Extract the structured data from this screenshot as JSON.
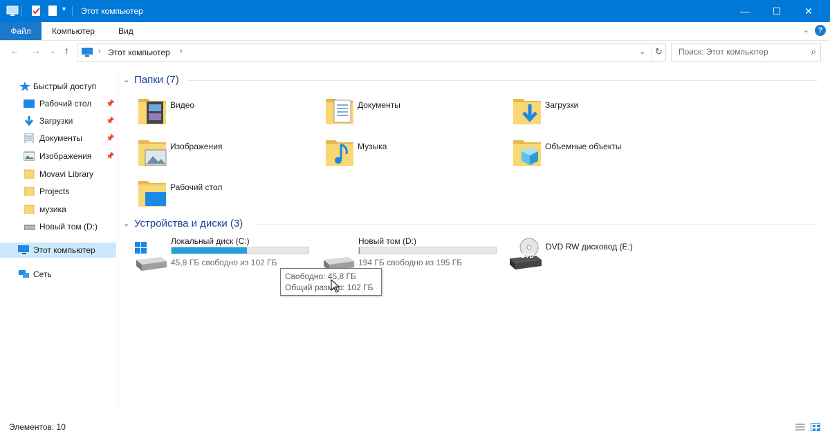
{
  "titlebar": {
    "title": "Этот компьютер",
    "controls": {
      "minimize": "—",
      "maximize": "☐",
      "close": "✕"
    }
  },
  "ribbon": {
    "file": "Файл",
    "tabs": [
      "Компьютер",
      "Вид"
    ],
    "help": "?"
  },
  "address": {
    "path": "Этот компьютер"
  },
  "search": {
    "placeholder": "Поиск: Этот компьютер"
  },
  "sidebar": {
    "items": [
      {
        "label": "Быстрый доступ",
        "icon": "star-icon"
      },
      {
        "label": "Рабочий стол",
        "icon": "desktop-folder-icon",
        "pinned": true
      },
      {
        "label": "Загрузки",
        "icon": "download-arrow-icon",
        "pinned": true
      },
      {
        "label": "Документы",
        "icon": "documents-icon",
        "pinned": true
      },
      {
        "label": "Изображения",
        "icon": "pictures-icon",
        "pinned": true
      },
      {
        "label": "Movavi Library",
        "icon": "folder-icon"
      },
      {
        "label": "Projects",
        "icon": "folder-icon"
      },
      {
        "label": "музика",
        "icon": "folder-icon"
      },
      {
        "label": "Новый том (D:)",
        "icon": "drive-icon"
      },
      {
        "label": "Этот компьютер",
        "icon": "computer-icon",
        "selected": true
      },
      {
        "label": "Сеть",
        "icon": "network-icon"
      }
    ]
  },
  "groups": {
    "folders": {
      "title": "Папки (7)",
      "items": [
        {
          "name": "Видео",
          "icon": "video-folder-icon"
        },
        {
          "name": "Документы",
          "icon": "documents-folder-icon"
        },
        {
          "name": "Загрузки",
          "icon": "downloads-folder-icon"
        },
        {
          "name": "Изображения",
          "icon": "pictures-folder-icon"
        },
        {
          "name": "Музыка",
          "icon": "music-folder-icon"
        },
        {
          "name": "Объемные объекты",
          "icon": "3d-objects-folder-icon"
        },
        {
          "name": "Рабочий стол",
          "icon": "desktop-folder-icon"
        }
      ]
    },
    "devices": {
      "title": "Устройства и диски (3)",
      "items": [
        {
          "name": "Локальный диск (C:)",
          "free_text": "45,8 ГБ свободно из 102 ГБ",
          "used_fraction": 0.55,
          "icon": "windows-drive-icon"
        },
        {
          "name": "Новый том (D:)",
          "free_text": "194 ГБ свободно из 195 ГБ",
          "used_fraction": 0.005,
          "icon": "drive-icon"
        },
        {
          "name": "DVD RW дисковод (E:)",
          "icon": "dvd-drive-icon"
        }
      ]
    }
  },
  "tooltip": {
    "line1": "Свободно: 45,8 ГБ",
    "line2": "Общий размер: 102 ГБ"
  },
  "status": {
    "count": "Элементов: 10"
  },
  "colors": {
    "accent": "#0078d7",
    "file_tab": "#1979ca",
    "bar_fill": "#26a0da",
    "group_title": "#1e3f9a",
    "selected": "#cce8ff"
  }
}
